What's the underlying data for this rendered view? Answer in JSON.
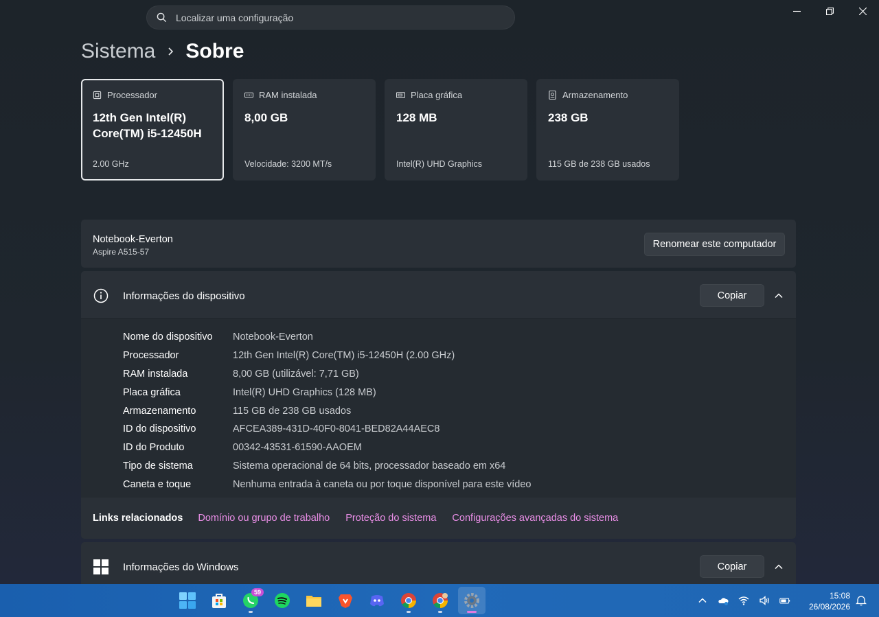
{
  "search": {
    "placeholder": "Localizar uma configuração"
  },
  "breadcrumb": {
    "parent": "Sistema",
    "current": "Sobre"
  },
  "cards": [
    {
      "icon": "processor-icon",
      "label": "Processador",
      "value": "12th Gen Intel(R) Core(TM) i5-12450H",
      "sub": "2.00 GHz"
    },
    {
      "icon": "ram-icon",
      "label": "RAM instalada",
      "value": "8,00 GB",
      "sub": "Velocidade: 3200 MT/s"
    },
    {
      "icon": "gpu-icon",
      "label": "Placa gráfica",
      "value": "128 MB",
      "sub": "Intel(R) UHD Graphics"
    },
    {
      "icon": "storage-icon",
      "label": "Armazenamento",
      "value": "238 GB",
      "sub": "115 GB de 238 GB usados"
    }
  ],
  "computer": {
    "name": "Notebook-Everton",
    "model": "Aspire A515-57",
    "rename_label": "Renomear este computador"
  },
  "device_info": {
    "title": "Informações do dispositivo",
    "copy_label": "Copiar",
    "rows": [
      {
        "label": "Nome do dispositivo",
        "value": "Notebook-Everton"
      },
      {
        "label": "Processador",
        "value": "12th Gen Intel(R) Core(TM) i5-12450H (2.00 GHz)"
      },
      {
        "label": "RAM instalada",
        "value": "8,00 GB (utilizável: 7,71 GB)"
      },
      {
        "label": "Placa gráfica",
        "value": "Intel(R) UHD Graphics (128 MB)"
      },
      {
        "label": "Armazenamento",
        "value": "115 GB de 238 GB usados"
      },
      {
        "label": "ID do dispositivo",
        "value": "AFCEA389-431D-40F0-8041-BED82A44AEC8"
      },
      {
        "label": "ID do Produto",
        "value": "00342-43531-61590-AAOEM"
      },
      {
        "label": "Tipo de sistema",
        "value": "Sistema operacional de 64 bits, processador baseado em x64"
      },
      {
        "label": "Caneta e toque",
        "value": "Nenhuma entrada à caneta ou por toque disponível para este vídeo"
      }
    ],
    "links_label": "Links relacionados",
    "links": [
      "Domínio ou grupo de trabalho",
      "Proteção do sistema",
      "Configurações avançadas do sistema"
    ]
  },
  "windows_info": {
    "title": "Informações do Windows",
    "copy_label": "Copiar"
  },
  "taskbar": {
    "apps": [
      {
        "name": "start-icon"
      },
      {
        "name": "store-icon"
      },
      {
        "name": "whatsapp-icon",
        "badge": "59"
      },
      {
        "name": "spotify-icon"
      },
      {
        "name": "file-explorer-icon"
      },
      {
        "name": "brave-icon"
      },
      {
        "name": "discord-icon"
      },
      {
        "name": "chrome-icon"
      },
      {
        "name": "chrome-profile-icon"
      },
      {
        "name": "settings-icon"
      }
    ],
    "time": "15:08",
    "date": "26/08/2026"
  },
  "colors": {
    "link": "#eb8fe8",
    "taskbar": "#1f66b3",
    "panel": "#2a3037"
  }
}
